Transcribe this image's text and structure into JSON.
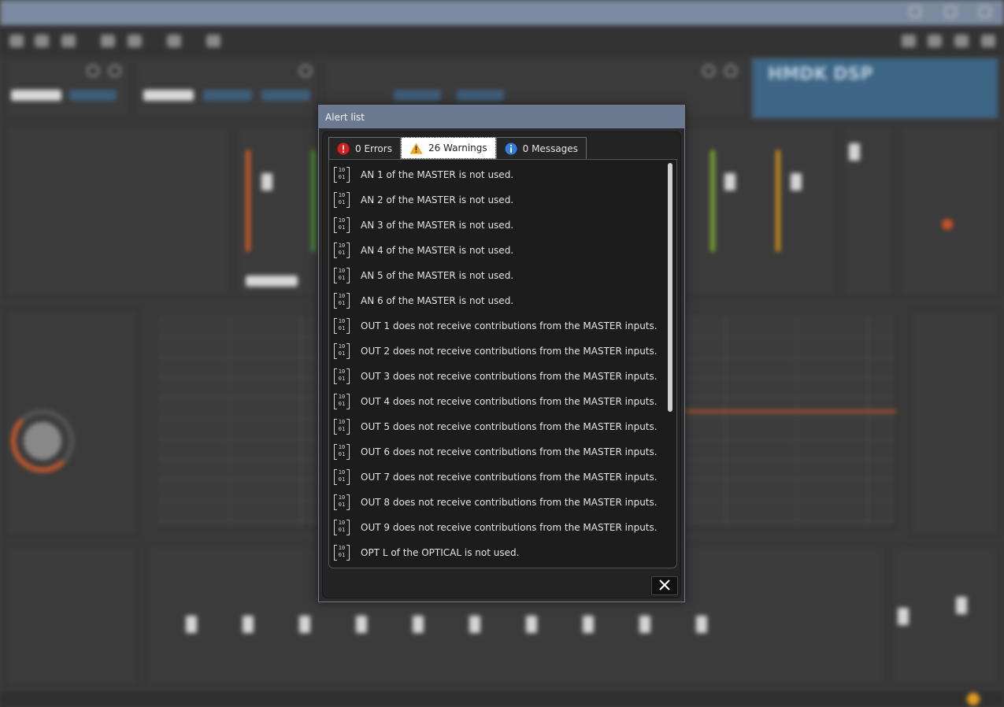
{
  "background_app": {
    "dsp_title": "HMDK DSP"
  },
  "dialog": {
    "title": "Alert list",
    "tabs": [
      {
        "label": "0 Errors",
        "icon": "error-icon",
        "color": "#e01b1b"
      },
      {
        "label": "26 Warnings",
        "icon": "warning-icon",
        "color": "#f2a51a"
      },
      {
        "label": "0 Messages",
        "icon": "info-icon",
        "color": "#2f7fe0"
      }
    ],
    "active_tab": "26 Warnings",
    "binary_icon_digits": [
      "10",
      "01"
    ],
    "warnings": [
      "AN 1 of the MASTER is not used.",
      "AN 2 of the MASTER is not used.",
      "AN 3 of the MASTER is not used.",
      "AN 4 of the MASTER is not used.",
      "AN 5 of the MASTER is not used.",
      "AN 6 of the MASTER is not used.",
      "OUT 1 does not receive contributions from the MASTER inputs.",
      "OUT 2 does not receive contributions from the MASTER inputs.",
      "OUT 3 does not receive contributions from the MASTER inputs.",
      "OUT 4 does not receive contributions from the MASTER inputs.",
      "OUT 5 does not receive contributions from the MASTER inputs.",
      "OUT 6 does not receive contributions from the MASTER inputs.",
      "OUT 7 does not receive contributions from the MASTER inputs.",
      "OUT 8 does not receive contributions from the MASTER inputs.",
      "OUT 9 does not receive contributions from the MASTER inputs.",
      "OPT L of the OPTICAL is not used."
    ],
    "close_icon": "close-icon"
  }
}
